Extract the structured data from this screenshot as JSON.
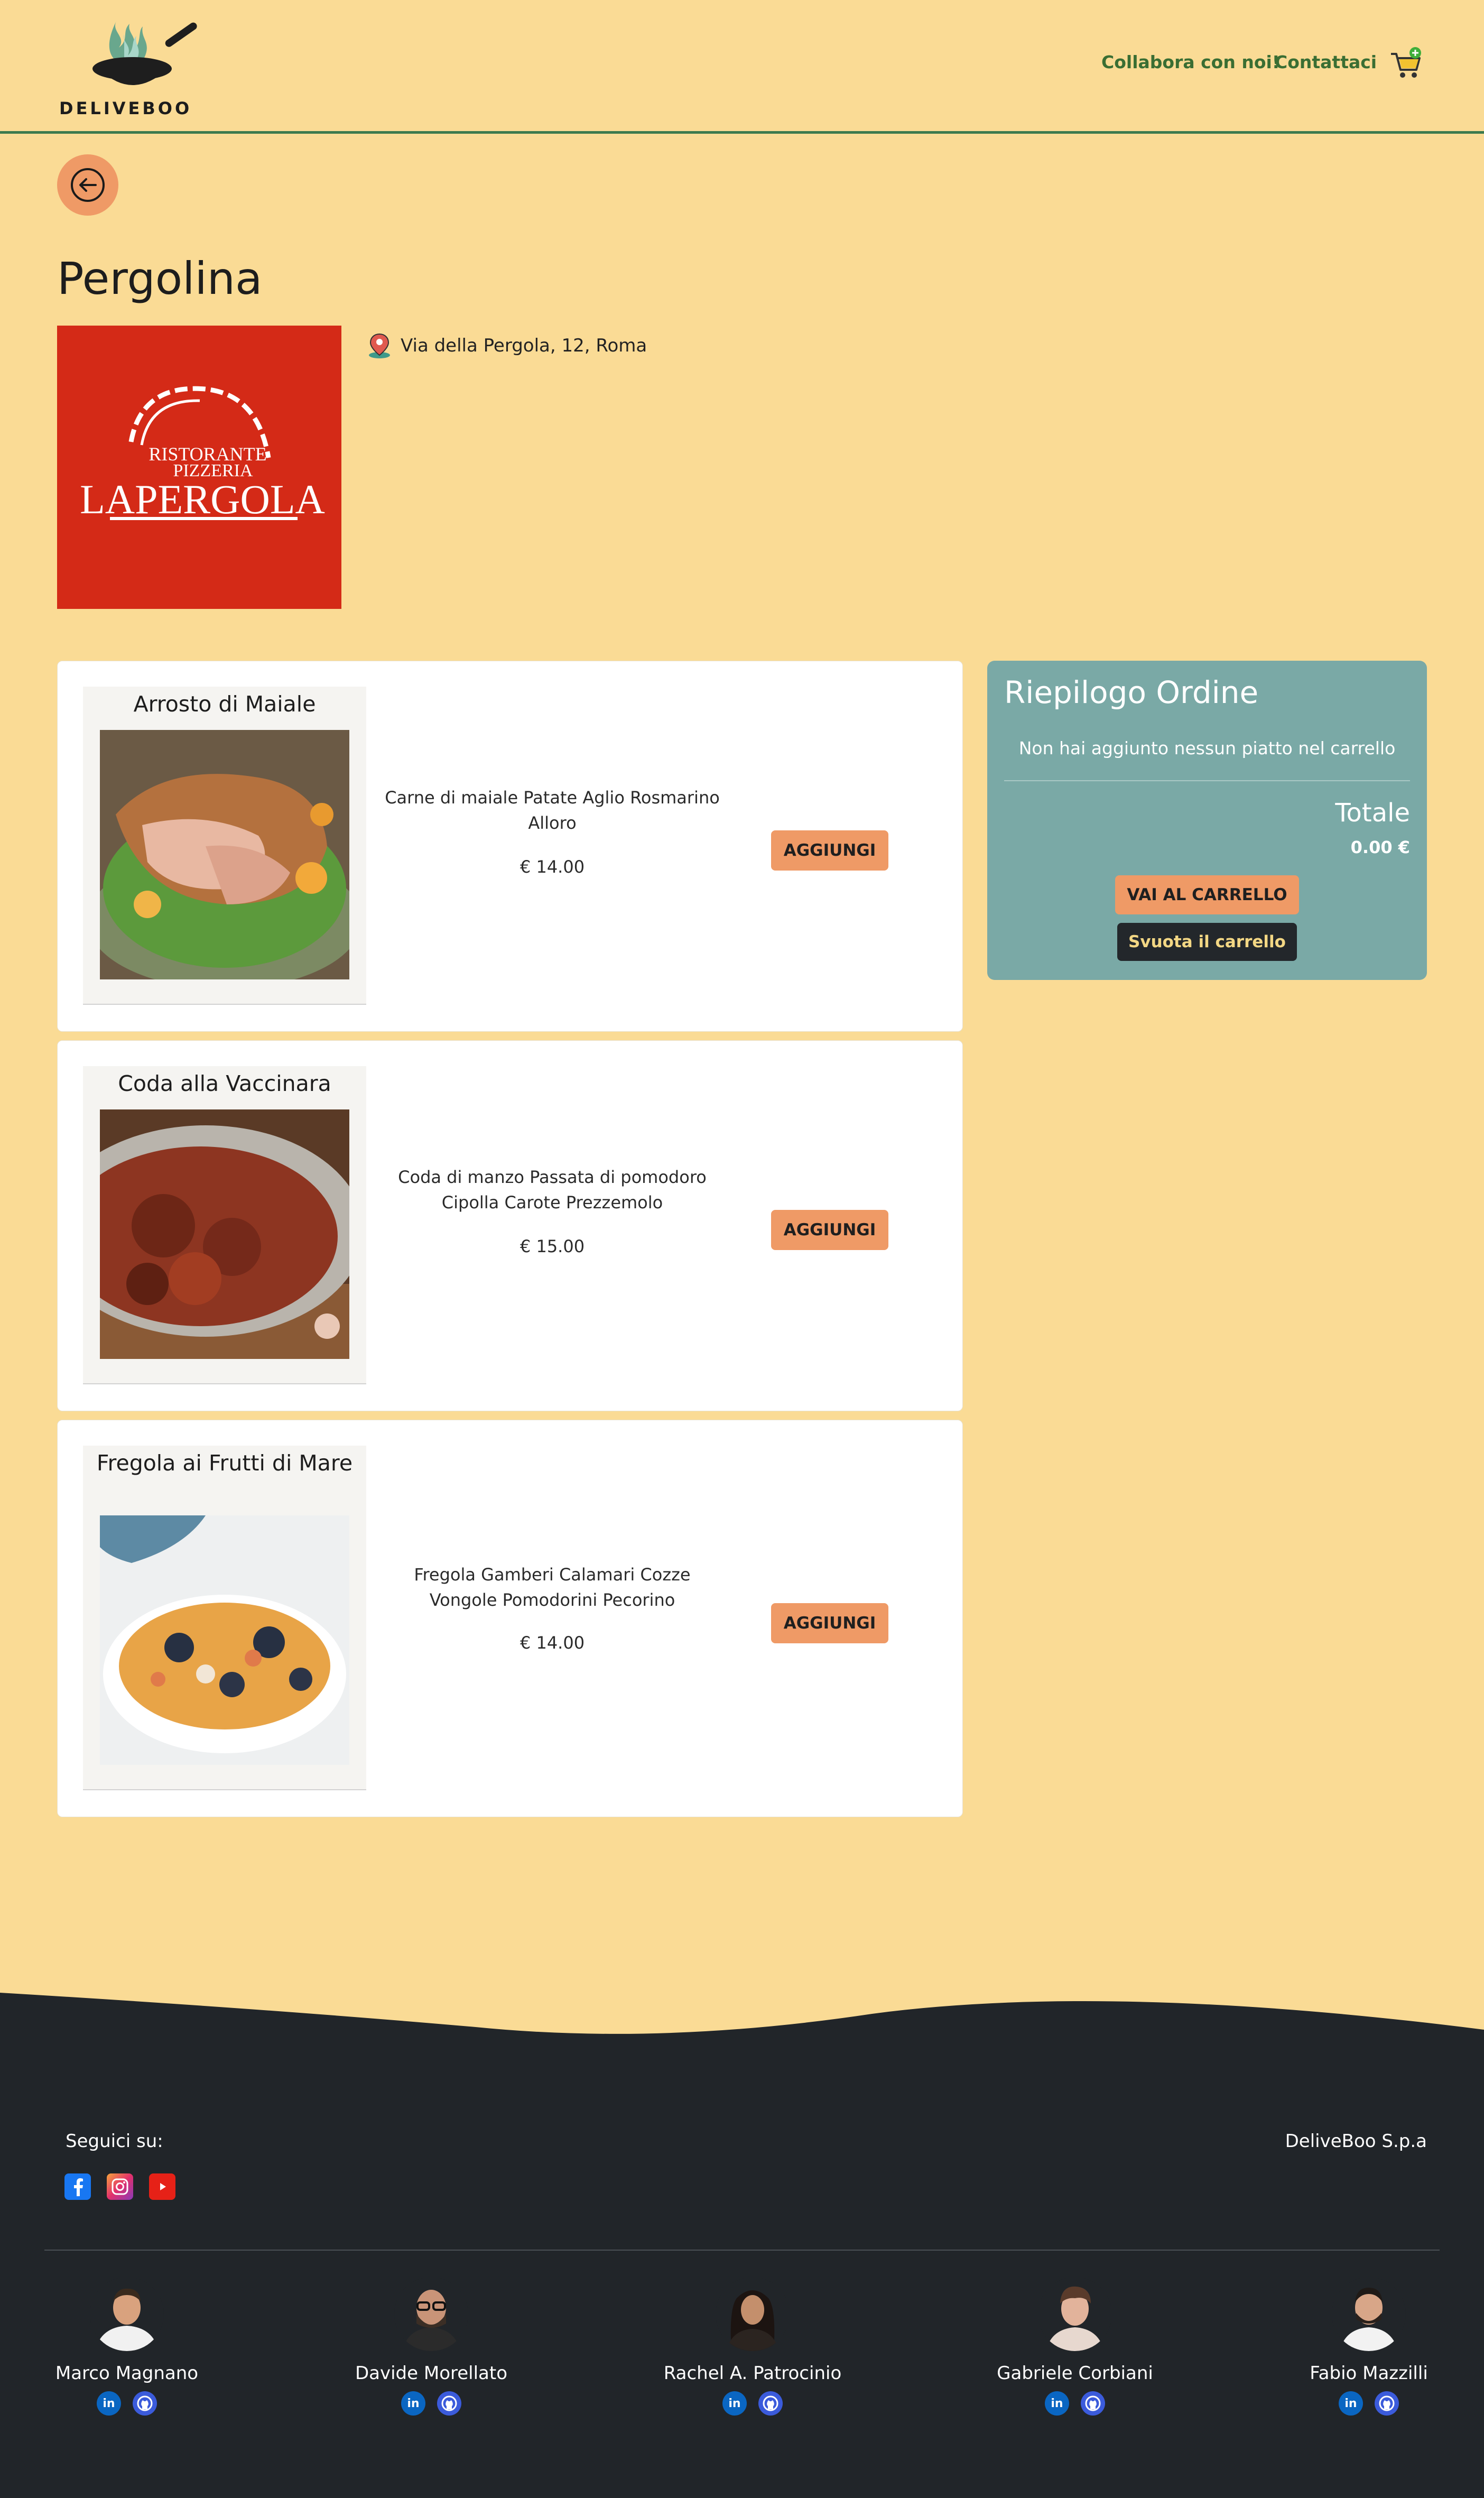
{
  "header": {
    "brand": "DELIVEBOO",
    "nav": [
      "Collabora con noi!",
      "Contattaci"
    ],
    "cart_icon": "cart-icon"
  },
  "restaurant": {
    "name": "Pergolina",
    "address": "Via della Pergola, 12, Roma",
    "logo_text": {
      "line1": "RISTORANTE",
      "line2": "PIZZERIA",
      "line3": "LAPERGOLA"
    }
  },
  "dishes": [
    {
      "name": "Arrosto di Maiale",
      "description": "Carne di maiale Patate Aglio Rosmarino Alloro",
      "price": "€ 14.00",
      "button": "AGGIUNGI"
    },
    {
      "name": "Coda alla Vaccinara",
      "description": "Coda di manzo Passata di pomodoro Cipolla Carote Prezzemolo",
      "price": "€ 15.00",
      "button": "AGGIUNGI"
    },
    {
      "name": "Fregola ai Frutti di Mare",
      "description": "Fregola Gamberi Calamari Cozze Vongole Pomodorini Pecorino",
      "price": "€ 14.00",
      "button": "AGGIUNGI"
    }
  ],
  "summary": {
    "title": "Riepilogo Ordine",
    "empty_text": "Non hai aggiunto nessun piatto nel carrello",
    "total_label": "Totale",
    "total_value": "0.00 €",
    "go_cart": "VAI AL CARRELLO",
    "empty_cart": "Svuota il carrello"
  },
  "footer": {
    "follow_label": "Seguici su:",
    "company": "DeliveBoo S.p.a",
    "socials": [
      "facebook-icon",
      "instagram-icon",
      "youtube-icon"
    ],
    "team": [
      {
        "name": "Marco Magnano"
      },
      {
        "name": "Davide Morellato"
      },
      {
        "name": "Rachel A. Patrocinio"
      },
      {
        "name": "Gabriele Corbiani"
      },
      {
        "name": "Fabio Mazzilli"
      }
    ]
  },
  "colors": {
    "background": "#fadb95",
    "accent": "#ef9a66",
    "nav_green": "#3a6e33",
    "summary_bg": "#7aa9a6",
    "footer_bg": "#212529",
    "logo_red": "#d42a17"
  }
}
